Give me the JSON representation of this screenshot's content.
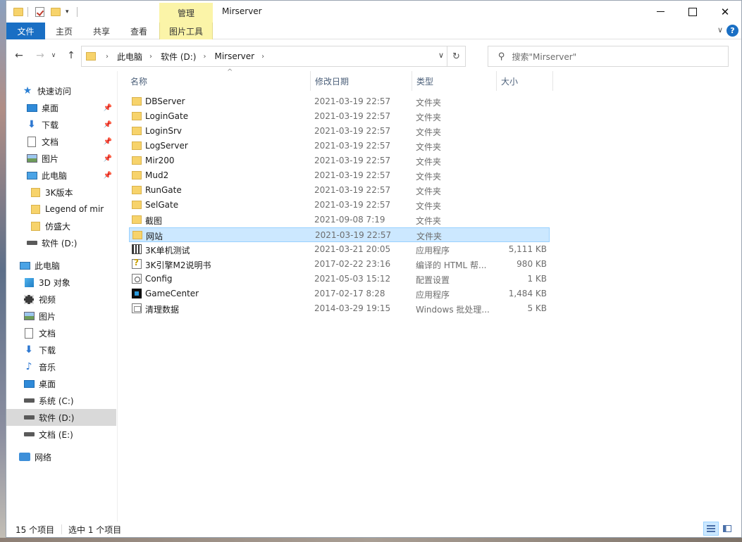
{
  "window": {
    "title": "Mirserver",
    "context_tab_group": "管理",
    "controls": {
      "minimize": "",
      "maximize": "",
      "close": "✕"
    }
  },
  "quick_access_toolbar": {
    "dropdown": "▾"
  },
  "ribbon": {
    "tabs": [
      {
        "label": "文件",
        "name": "tab-file"
      },
      {
        "label": "主页",
        "name": "tab-home"
      },
      {
        "label": "共享",
        "name": "tab-share"
      },
      {
        "label": "查看",
        "name": "tab-view"
      },
      {
        "label": "图片工具",
        "name": "tab-picture-tools"
      }
    ],
    "expand_glyph": "∨",
    "help_glyph": "?"
  },
  "nav": {
    "back": "←",
    "forward": "→",
    "recent": "∨",
    "up": "↑",
    "breadcrumb": [
      "此电脑",
      "软件 (D:)",
      "Mirserver"
    ],
    "crumb_sep": "›",
    "dropdown": "∨",
    "refresh": "↻",
    "search_placeholder": "搜索\"Mirserver\"",
    "search_glyph": "⚲"
  },
  "sidebar": {
    "pin_glyph": "📌",
    "items": [
      {
        "label": "快速访问",
        "icon": "star-icon",
        "pinned": false
      },
      {
        "label": "桌面",
        "icon": "desktop-icon",
        "pinned": true
      },
      {
        "label": "下载",
        "icon": "download-icon",
        "pinned": true
      },
      {
        "label": "文档",
        "icon": "document-icon",
        "pinned": true
      },
      {
        "label": "图片",
        "icon": "picture-icon",
        "pinned": true
      },
      {
        "label": "此电脑",
        "icon": "computer-icon",
        "pinned": true
      },
      {
        "label": "3K版本",
        "icon": "folder-icon",
        "pinned": false
      },
      {
        "label": "Legend of mir",
        "icon": "folder-icon",
        "pinned": false
      },
      {
        "label": "仿盛大",
        "icon": "folder-icon",
        "pinned": false
      },
      {
        "label": "软件 (D:)",
        "icon": "drive-icon",
        "pinned": false
      },
      {
        "label": "此电脑",
        "icon": "computer-icon",
        "pinned": false
      },
      {
        "label": "3D 对象",
        "icon": "3d-objects-icon",
        "pinned": false
      },
      {
        "label": "视频",
        "icon": "video-icon",
        "pinned": false
      },
      {
        "label": "图片",
        "icon": "picture-icon",
        "pinned": false
      },
      {
        "label": "文档",
        "icon": "document-icon",
        "pinned": false
      },
      {
        "label": "下载",
        "icon": "download-icon",
        "pinned": false
      },
      {
        "label": "音乐",
        "icon": "music-icon",
        "pinned": false
      },
      {
        "label": "桌面",
        "icon": "desktop-icon",
        "pinned": false
      },
      {
        "label": "系统 (C:)",
        "icon": "drive-icon",
        "pinned": false
      },
      {
        "label": "软件 (D:)",
        "icon": "drive-icon",
        "pinned": false,
        "active": true
      },
      {
        "label": "文档 (E:)",
        "icon": "drive-icon",
        "pinned": false
      },
      {
        "label": "网络",
        "icon": "network-icon",
        "pinned": false
      }
    ]
  },
  "file_list": {
    "columns": [
      "名称",
      "修改日期",
      "类型",
      "大小"
    ],
    "sort_glyph": "^",
    "rows": [
      {
        "name": "DBServer",
        "date": "2021-03-19 22:57",
        "type": "文件夹",
        "size": "",
        "icon": "folder-icon"
      },
      {
        "name": "LoginGate",
        "date": "2021-03-19 22:57",
        "type": "文件夹",
        "size": "",
        "icon": "folder-icon"
      },
      {
        "name": "LoginSrv",
        "date": "2021-03-19 22:57",
        "type": "文件夹",
        "size": "",
        "icon": "folder-icon"
      },
      {
        "name": "LogServer",
        "date": "2021-03-19 22:57",
        "type": "文件夹",
        "size": "",
        "icon": "folder-icon"
      },
      {
        "name": "Mir200",
        "date": "2021-03-19 22:57",
        "type": "文件夹",
        "size": "",
        "icon": "folder-icon"
      },
      {
        "name": "Mud2",
        "date": "2021-03-19 22:57",
        "type": "文件夹",
        "size": "",
        "icon": "folder-icon"
      },
      {
        "name": "RunGate",
        "date": "2021-03-19 22:57",
        "type": "文件夹",
        "size": "",
        "icon": "folder-icon"
      },
      {
        "name": "SelGate",
        "date": "2021-03-19 22:57",
        "type": "文件夹",
        "size": "",
        "icon": "folder-icon"
      },
      {
        "name": "截图",
        "date": "2021-09-08 7:19",
        "type": "文件夹",
        "size": "",
        "icon": "folder-icon"
      },
      {
        "name": "网站",
        "date": "2021-03-19 22:57",
        "type": "文件夹",
        "size": "",
        "icon": "folder-icon",
        "selected": true
      },
      {
        "name": "3K单机测试",
        "date": "2021-03-21 20:05",
        "type": "应用程序",
        "size": "5,111 KB",
        "icon": "application-icon"
      },
      {
        "name": "3K引擎M2说明书",
        "date": "2017-02-22 23:16",
        "type": "编译的 HTML 帮...",
        "size": "980 KB",
        "icon": "help-file-icon"
      },
      {
        "name": "Config",
        "date": "2021-05-03 15:12",
        "type": "配置设置",
        "size": "1 KB",
        "icon": "config-icon"
      },
      {
        "name": "GameCenter",
        "date": "2017-02-17 8:28",
        "type": "应用程序",
        "size": "1,484 KB",
        "icon": "game-app-icon"
      },
      {
        "name": "清理数据",
        "date": "2014-03-29 19:15",
        "type": "Windows 批处理...",
        "size": "5 KB",
        "icon": "batch-file-icon"
      }
    ]
  },
  "status": {
    "item_count": "15 个项目",
    "selection": "选中 1 个项目"
  },
  "colors": {
    "accent": "#1a6fc4",
    "context_tab": "#fbf4a8",
    "selection": "#cce8ff",
    "selection_border": "#99d1ff",
    "folder": "#f7d36b"
  }
}
